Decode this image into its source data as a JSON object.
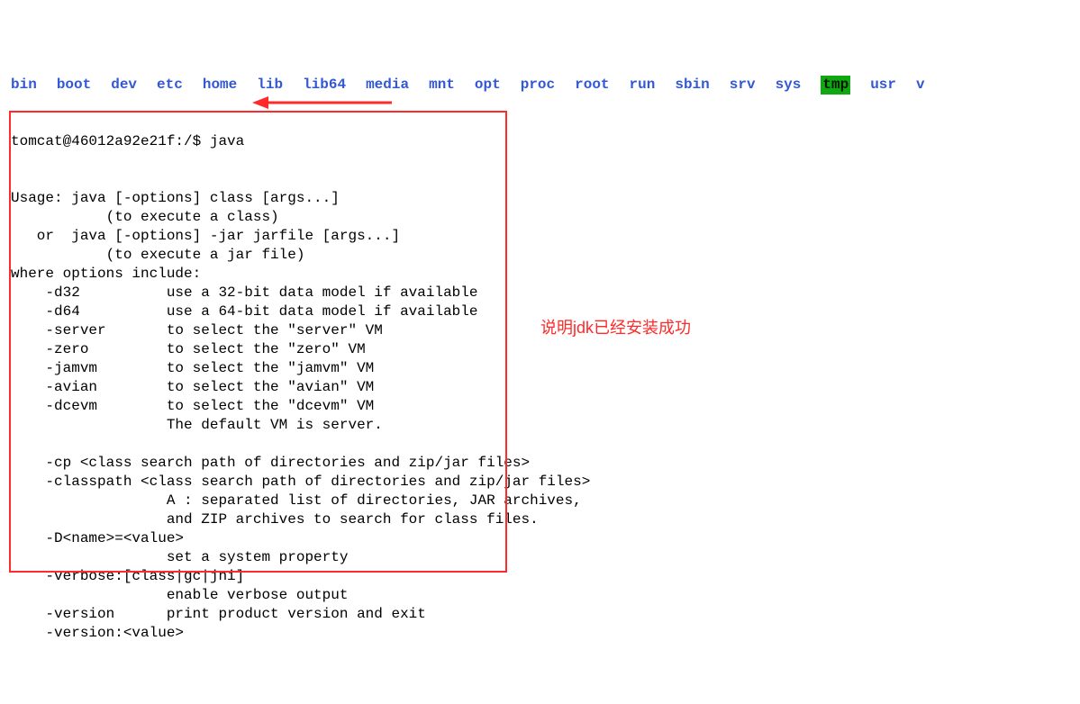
{
  "ls": {
    "items": [
      "bin",
      "boot",
      "dev",
      "etc",
      "home",
      "lib",
      "lib64",
      "media",
      "mnt",
      "opt",
      "proc",
      "root",
      "run",
      "sbin",
      "srv",
      "sys",
      "tmp",
      "usr",
      "v"
    ]
  },
  "prompt": "tomcat@46012a92e21f:/$ java",
  "output": [
    "Usage: java [-options] class [args...]",
    "           (to execute a class)",
    "   or  java [-options] -jar jarfile [args...]",
    "           (to execute a jar file)",
    "where options include:",
    "    -d32          use a 32-bit data model if available",
    "    -d64          use a 64-bit data model if available",
    "    -server       to select the \"server\" VM",
    "    -zero         to select the \"zero\" VM",
    "    -jamvm        to select the \"jamvm\" VM",
    "    -avian        to select the \"avian\" VM",
    "    -dcevm        to select the \"dcevm\" VM",
    "                  The default VM is server.",
    "",
    "    -cp <class search path of directories and zip/jar files>",
    "    -classpath <class search path of directories and zip/jar files>",
    "                  A : separated list of directories, JAR archives,",
    "                  and ZIP archives to search for class files.",
    "    -D<name>=<value>",
    "                  set a system property",
    "    -verbose:[class|gc|jni]",
    "                  enable verbose output",
    "    -version      print product version and exit",
    "    -version:<value>"
  ],
  "annotation": "说明jdk已经安装成功"
}
